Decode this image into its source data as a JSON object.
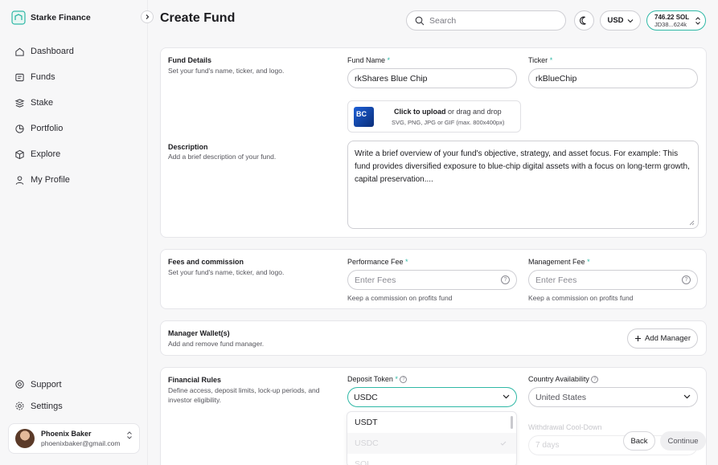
{
  "app": {
    "name": "Starke Finance",
    "accent": "#2fb8a6"
  },
  "sidebar": {
    "items": [
      {
        "label": "Dashboard",
        "icon": "home-icon"
      },
      {
        "label": "Funds",
        "icon": "funds-icon"
      },
      {
        "label": "Stake",
        "icon": "stack-icon"
      },
      {
        "label": "Portfolio",
        "icon": "pie-chart-icon"
      },
      {
        "label": "Explore",
        "icon": "cube-icon"
      },
      {
        "label": "My Profile",
        "icon": "user-icon"
      }
    ],
    "bottom_items": [
      {
        "label": "Support",
        "icon": "support-icon"
      },
      {
        "label": "Settings",
        "icon": "gear-icon"
      }
    ],
    "user": {
      "name": "Phoenix Baker",
      "email": "phoenixbaker@gmail.com"
    }
  },
  "header": {
    "title": "Create Fund",
    "search_placeholder": "Search",
    "currency": "USD",
    "wallet": {
      "balance": "746.22 SOL",
      "address": "JD38...624k"
    }
  },
  "fund_details": {
    "title": "Fund Details",
    "description": "Set your fund's name, ticker, and logo.",
    "fund_name_label": "Fund Name",
    "fund_name_value": "rkShares Blue Chip",
    "ticker_label": "Ticker",
    "ticker_value": "rkBlueChip",
    "required_mark": "*",
    "upload": {
      "logo_text": "BC",
      "click_text": "Click to upload",
      "drag_text": "or drag and drop",
      "formats": "SVG, PNG, JPG or GIF (max. 800x400px)"
    }
  },
  "description_section": {
    "title": "Description",
    "description": "Add a brief description of your fund.",
    "placeholder": "Write a brief overview of your fund's objective, strategy, and asset focus. For example: This fund provides diversified exposure to blue-chip digital assets with a focus on long-term growth, capital preservation...."
  },
  "fees": {
    "title": "Fees and commission",
    "description": "Set your fund's name, ticker, and logo.",
    "performance_label": "Performance Fee",
    "performance_placeholder": "Enter Fees",
    "performance_hint": "Keep a commission on profits fund",
    "management_label": "Management Fee",
    "management_placeholder": "Enter Fees",
    "management_hint": "Keep a commission on profits fund",
    "help_glyph": "?"
  },
  "wallets": {
    "title": "Manager Wallet(s)",
    "description": "Add and remove fund manager.",
    "add_button": "Add Manager"
  },
  "rules": {
    "title": "Financial Rules",
    "description": "Define access, deposit limits, lock-up periods, and investor eligibility.",
    "deposit_label": "Deposit Token",
    "deposit_value": "USDC",
    "country_label": "Country Availability",
    "country_value": "United States",
    "cooldown_label": "Withdrawal Cool-Down",
    "cooldown_value": "7 days",
    "dropdown_options": [
      "USDT",
      "USDC",
      "SOL"
    ]
  },
  "footer": {
    "back": "Back",
    "continue": "Continue"
  }
}
